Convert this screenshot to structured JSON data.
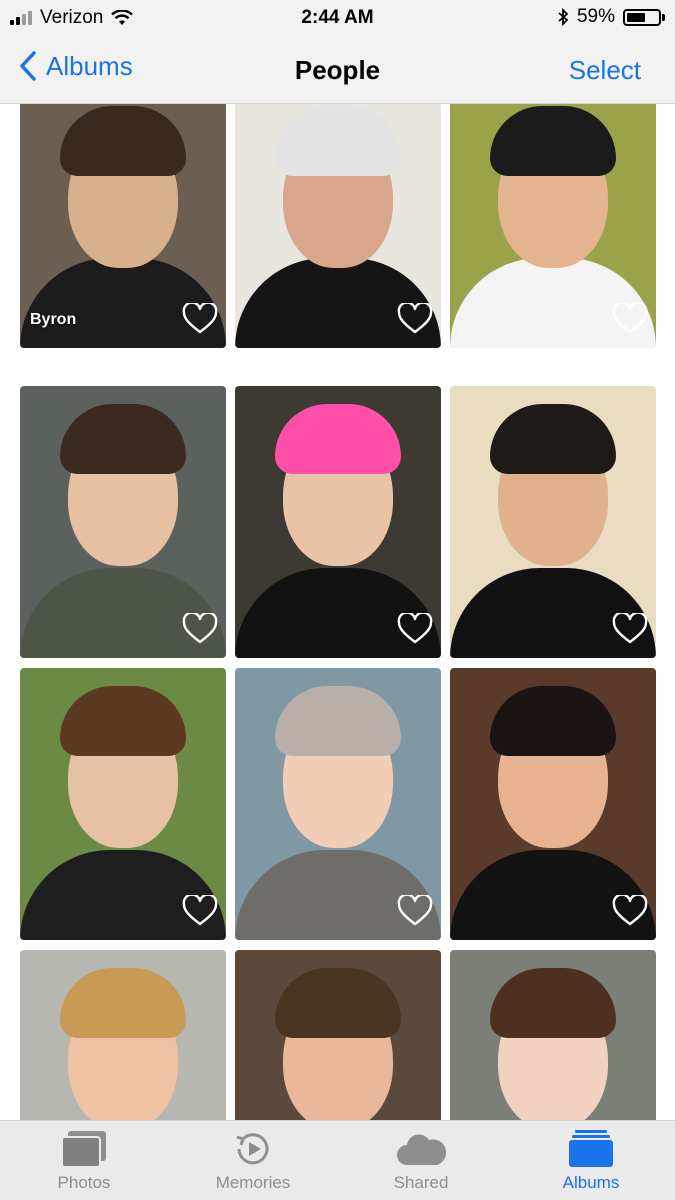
{
  "status_bar": {
    "carrier": "Verizon",
    "time": "2:44 AM",
    "battery": "59%",
    "battery_level": 0.59,
    "icons": [
      "signal-icon",
      "wifi-icon",
      "bluetooth-icon",
      "battery-icon"
    ]
  },
  "navbar": {
    "back_label": "Albums",
    "title": "People",
    "select_label": "Select"
  },
  "people": [
    {
      "name": "Byron",
      "bg": "#6b5f52",
      "skin": "#d9b08c",
      "hair": "#3a2a1e",
      "shirt": "#1c1c1c"
    },
    {
      "name": "",
      "bg": "#e9e6df",
      "skin": "#d8a68a",
      "hair": "#e4e4e4",
      "shirt": "#151515"
    },
    {
      "name": "",
      "bg": "#9aa24a",
      "skin": "#e3b48f",
      "hair": "#1b1b1b",
      "shirt": "#f4f4f4"
    },
    {
      "name": "",
      "bg": "#5b625d",
      "skin": "#e7c0a2",
      "hair": "#3a2a1f",
      "shirt": "#4d5448"
    },
    {
      "name": "",
      "bg": "#3d3a34",
      "skin": "#eac3a7",
      "hair": "#ff4fa8",
      "shirt": "#111111"
    },
    {
      "name": "",
      "bg": "#e9dcc0",
      "skin": "#e1b08d",
      "hair": "#1d1a18",
      "shirt": "#111111"
    },
    {
      "name": "",
      "bg": "#6b8a45",
      "skin": "#e6c1a4",
      "hair": "#5c3a22",
      "shirt": "#1e1e1e"
    },
    {
      "name": "",
      "bg": "#7f98a4",
      "skin": "#f0cdb4",
      "hair": "#b8b0a8",
      "shirt": "#6f6d6a"
    },
    {
      "name": "",
      "bg": "#5a3a2a",
      "skin": "#e6b28f",
      "hair": "#1a1513",
      "shirt": "#121212"
    },
    {
      "name": "",
      "bg": "#b7b7b2",
      "skin": "#efc2a3",
      "hair": "#c79a56",
      "shirt": "#3c5a8c"
    },
    {
      "name": "",
      "bg": "#5b4a3c",
      "skin": "#e9b89b",
      "hair": "#4a3422",
      "shirt": "#f0f0f0"
    },
    {
      "name": "",
      "bg": "#7b7f76",
      "skin": "#f1d1bf",
      "hair": "#4d3020",
      "shirt": "#2a2a2a"
    }
  ],
  "tabs": [
    {
      "label": "Photos",
      "icon": "photos-icon",
      "active": false
    },
    {
      "label": "Memories",
      "icon": "memories-icon",
      "active": false
    },
    {
      "label": "Shared",
      "icon": "cloud-icon",
      "active": false
    },
    {
      "label": "Albums",
      "icon": "albums-icon",
      "active": true
    }
  ],
  "colors": {
    "accent": "#1a73e8",
    "inactive": "#8e8e8e",
    "bar_bg": "#f2f2f2"
  }
}
